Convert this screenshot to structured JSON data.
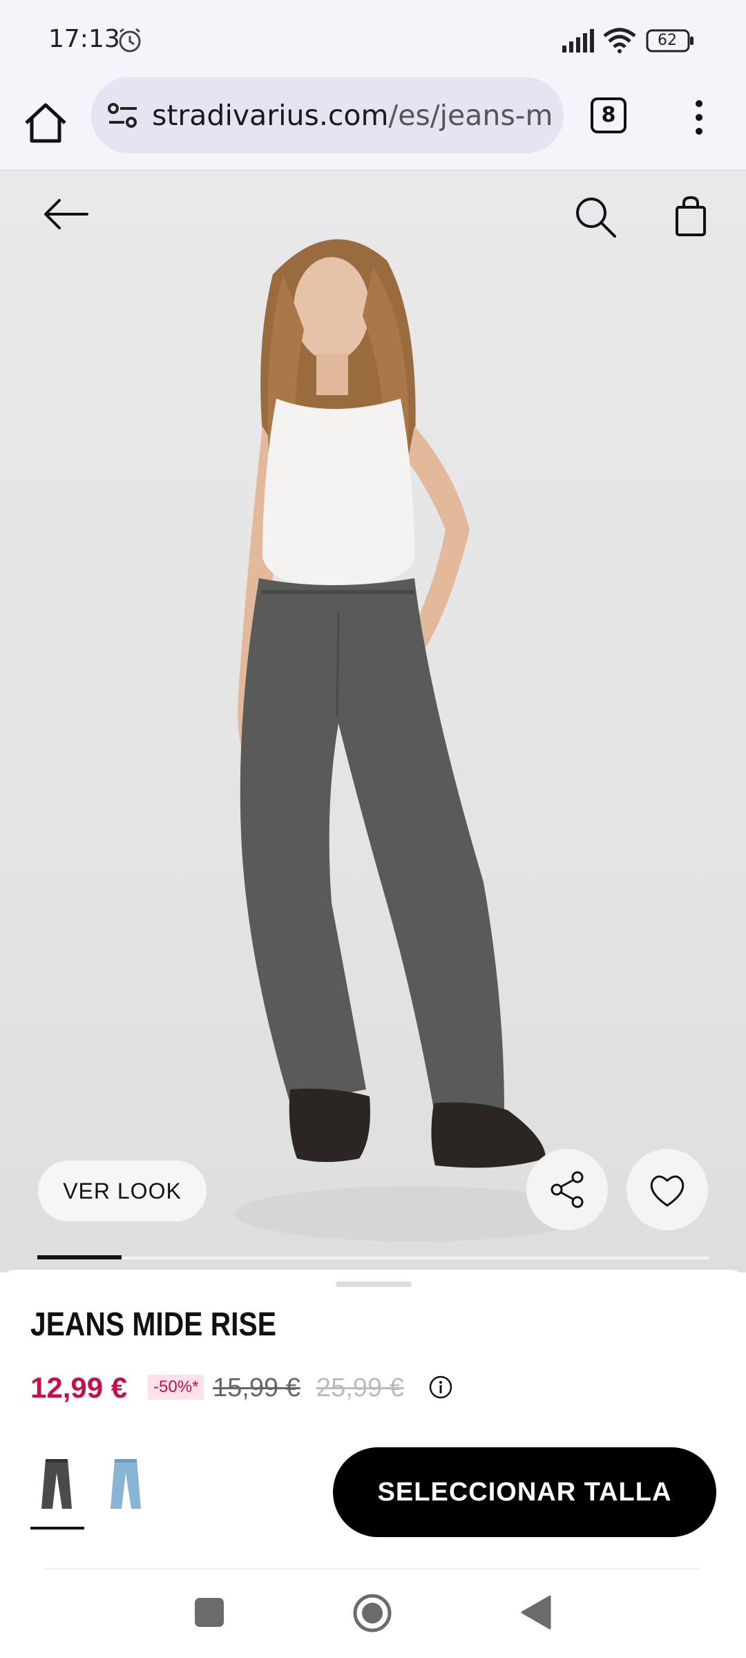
{
  "status_bar": {
    "time": "17:13",
    "battery": "62"
  },
  "browser": {
    "url_domain": "stradivarius.com",
    "url_path": "/es/jeans-mi",
    "tab_count": "8"
  },
  "product": {
    "title": "JEANS MIDE RISE",
    "price_current": "12,99 €",
    "discount": "-50%*",
    "price_old_1": "15,99 €",
    "price_old_2": "25,99 €",
    "ver_look_label": "VER LOOK",
    "select_size_label": "SELECCIONAR TALLA",
    "colors": [
      {
        "name": "gris",
        "hex": "#4a4a4a"
      },
      {
        "name": "azul claro",
        "hex": "#8ab4d4"
      }
    ],
    "image_count_indicator_index": 1
  },
  "icons": [
    "alarm-icon",
    "signal-icon",
    "wifi-icon",
    "battery-icon",
    "home-icon",
    "site-settings-icon",
    "tabs-icon",
    "menu-icon",
    "back-arrow-icon",
    "search-icon",
    "bag-icon",
    "share-icon",
    "heart-icon",
    "info-icon"
  ],
  "colors": {
    "price_accent": "#c2114d",
    "button_bg": "#000000",
    "badge_bg": "#fbe1ea"
  }
}
